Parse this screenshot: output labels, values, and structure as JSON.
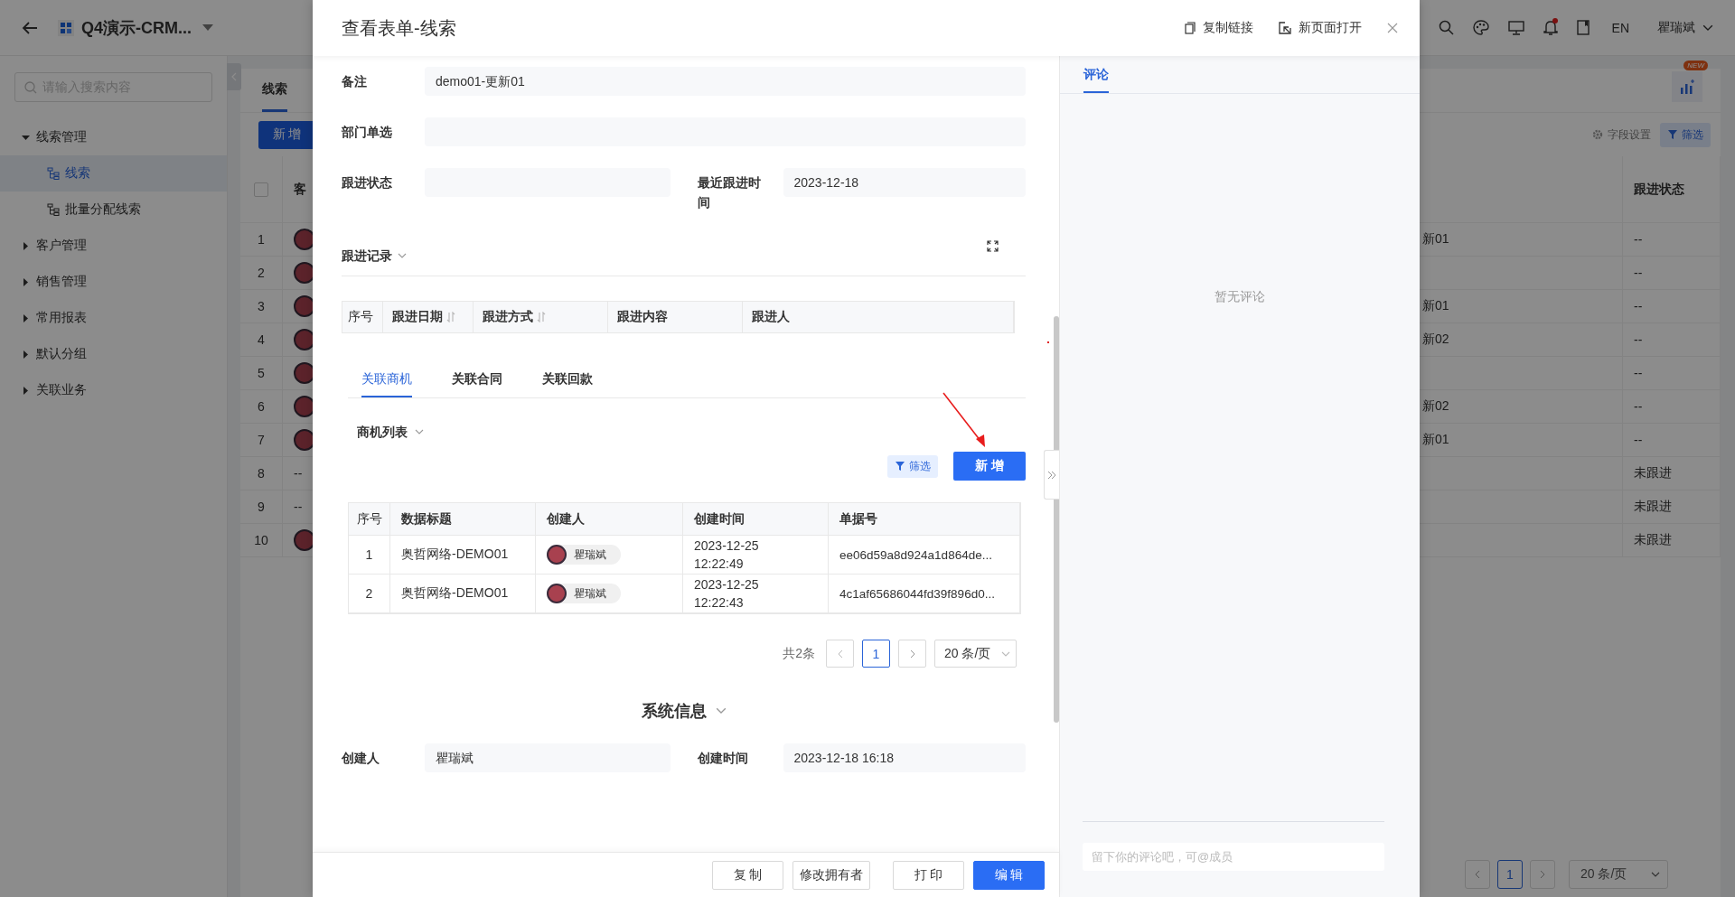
{
  "app_bar": {
    "title": "Q4演示-CRM...",
    "language": "EN",
    "user": "瞿瑞斌",
    "notifications_unread": true
  },
  "sidebar": {
    "search_placeholder": "请输入搜索内容",
    "items": [
      {
        "label": "线索管理",
        "expanded": true,
        "children": [
          {
            "label": "线索",
            "selected": true
          },
          {
            "label": "批量分配线索",
            "selected": false
          }
        ]
      },
      {
        "label": "客户管理",
        "expanded": false
      },
      {
        "label": "销售管理",
        "expanded": false
      },
      {
        "label": "常用报表",
        "expanded": false
      },
      {
        "label": "默认分组",
        "expanded": false
      },
      {
        "label": "关联业务",
        "expanded": false
      }
    ]
  },
  "main": {
    "tab": "线索",
    "all_selected": false,
    "new_badge": "NEW",
    "add_button": "新 增",
    "field_settings": "字段设置",
    "filter": "筛选",
    "column_2": "客",
    "column_4": "跟进状态",
    "rows": [
      {
        "number": "1",
        "customer": {
          "kind": "avatar"
        },
        "column_3": "新01",
        "status": "--"
      },
      {
        "number": "2",
        "customer": {
          "kind": "avatar"
        },
        "status": "--"
      },
      {
        "number": "3",
        "customer": {
          "kind": "avatar"
        },
        "column_3": "新01",
        "status": "--"
      },
      {
        "number": "4",
        "customer": {
          "kind": "avatar"
        },
        "column_3": "新02",
        "status": "--"
      },
      {
        "number": "5",
        "customer": {
          "kind": "avatar"
        },
        "status": "--"
      },
      {
        "number": "6",
        "customer": {
          "kind": "avatar"
        },
        "column_3": "新02",
        "status": "--"
      },
      {
        "number": "7",
        "customer": {
          "kind": "avatar"
        },
        "column_3": "新01",
        "status": "--"
      },
      {
        "number": "8",
        "customer": {
          "kind": "text",
          "text": "--"
        },
        "status": "未跟进"
      },
      {
        "number": "9",
        "customer": {
          "kind": "text",
          "text": "--"
        },
        "status": "未跟进"
      },
      {
        "number": "10",
        "customer": {
          "kind": "avatar"
        },
        "status": "未跟进"
      }
    ],
    "pagination": {
      "pages": [
        {
          "label": "1",
          "selected": true
        }
      ],
      "page_size": "20 条/页"
    }
  },
  "modal": {
    "title": "查看表单-线索",
    "copy_link": "复制链接",
    "open_new_page": "新页面打开",
    "fields": [
      {
        "label": "备注",
        "value": "demo01-更新01"
      },
      {
        "label": "部门单选"
      }
    ],
    "half_fields": [
      {
        "label": "跟进状态"
      },
      {
        "label": "最近跟进时间",
        "value": "2023-12-18"
      }
    ],
    "follow_up": {
      "title": "跟进记录",
      "columns": [
        {
          "label": "序号",
          "sortable": false
        },
        {
          "label": "跟进日期",
          "sortable": true
        },
        {
          "label": "跟进方式",
          "sortable": true
        },
        {
          "label": "跟进内容",
          "sortable": false
        },
        {
          "label": "跟进人",
          "sortable": false
        }
      ]
    },
    "tabs": [
      {
        "label": "关联商机",
        "selected": true
      },
      {
        "label": "关联合同",
        "selected": false
      },
      {
        "label": "关联回款",
        "selected": false
      }
    ],
    "opportunities": {
      "title": "商机列表",
      "filter": "筛选",
      "add_button": "新 增",
      "columns": [
        "序号",
        "数据标题",
        "创建人",
        "创建时间",
        "单据号"
      ],
      "rows": [
        {
          "number": "1",
          "title": "奥哲网络-DEMO01",
          "creator": "瞿瑞斌",
          "created": "2023-12-25 12:22:49",
          "doc_no": "ee06d59a8d924a1d864de..."
        },
        {
          "number": "2",
          "title": "奥哲网络-DEMO01",
          "creator": "瞿瑞斌",
          "created": "2023-12-25 12:22:43",
          "doc_no": "4c1af65686044fd39f896d0..."
        }
      ],
      "total": "共2条",
      "pages": [
        {
          "label": "1",
          "selected": true
        }
      ],
      "page_size": "20 条/页"
    },
    "system_info": {
      "title": "系统信息",
      "fields": [
        {
          "label": "创建人",
          "value": "瞿瑞斌"
        },
        {
          "label": "创建时间",
          "value": "2023-12-18 16:18"
        }
      ]
    },
    "footer_buttons": [
      {
        "label": "复 制",
        "primary": false
      },
      {
        "label": "修改拥有者",
        "primary": false
      },
      {
        "label": "打 印",
        "primary": false
      },
      {
        "label": "编 辑",
        "primary": true
      }
    ],
    "comments": {
      "tab": "评论",
      "tab_selected": true,
      "empty_text": "暂无评论",
      "placeholder": "留下你的评论吧，可@成员"
    }
  }
}
